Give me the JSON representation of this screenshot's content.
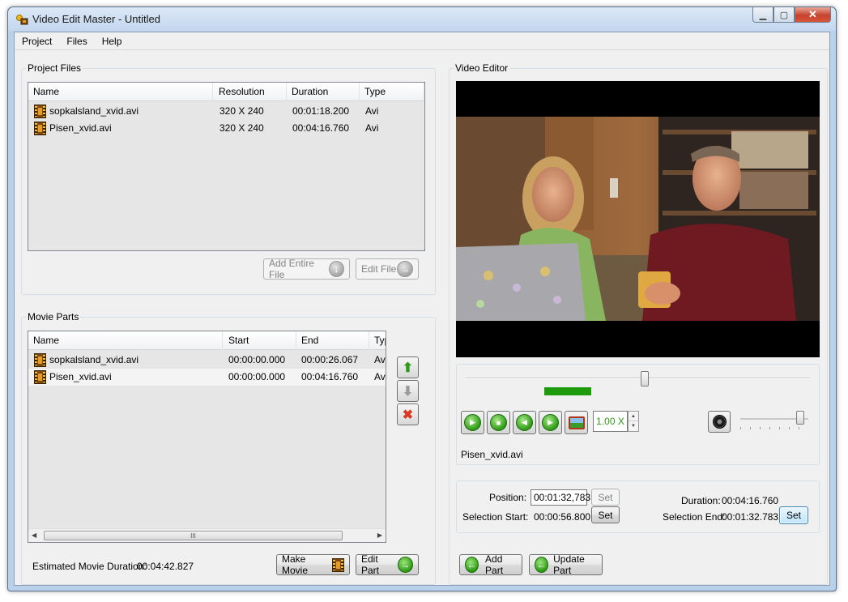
{
  "window": {
    "title": "Video Edit Master - Untitled"
  },
  "menu": {
    "items": [
      "Project",
      "Files",
      "Help"
    ]
  },
  "project_files": {
    "label": "Project Files",
    "columns": [
      "Name",
      "Resolution",
      "Duration",
      "Type"
    ],
    "rows": [
      {
        "name": "sopkalsland_xvid.avi",
        "resolution": "320 X 240",
        "duration": "00:01:18.200",
        "type": "Avi"
      },
      {
        "name": "Pisen_xvid.avi",
        "resolution": "320 X 240",
        "duration": "00:04:16.760",
        "type": "Avi"
      }
    ],
    "add_entire_file": "Add Entire File",
    "edit_file": "Edit File"
  },
  "movie_parts": {
    "label": "Movie Parts",
    "columns": [
      "Name",
      "Start",
      "End",
      "Typ"
    ],
    "rows": [
      {
        "name": "sopkalsland_xvid.avi",
        "start": "00:00:00.000",
        "end": "00:00:26.067",
        "type": "Avi"
      },
      {
        "name": "Pisen_xvid.avi",
        "start": "00:00:00.000",
        "end": "00:04:16.760",
        "type": "Avi"
      }
    ],
    "scroll_grip": "III",
    "estimated_label": "Estimated Movie Duration:",
    "estimated_value": "00:04:42.827",
    "make_movie": "Make Movie",
    "edit_part": "Edit Part"
  },
  "video_editor": {
    "label": "Video Editor",
    "speed": "1.00 X",
    "speed_up": "▲",
    "speed_down": "▼",
    "current_file": "Pisen_xvid.avi",
    "timeline_progress": 0.52,
    "volume_level": 0.88,
    "position_label": "Position:",
    "position_value": "00:01:32,783",
    "position_set": "Set",
    "duration_label": "Duration:",
    "duration_value": "00:04:16.760",
    "selection_start_label": "Selection Start:",
    "selection_start_value": "00:00:56.800",
    "selection_start_set": "Set",
    "selection_end_label": "Selection End:",
    "selection_end_value": "00:01:32.783",
    "selection_end_set": "Set",
    "add_part": "Add Part",
    "update_part": "Update Part"
  },
  "colors": {
    "accent_green": "#2d9a15",
    "selection_bar": "#1d9b0c",
    "delete_red": "#d83a22"
  }
}
